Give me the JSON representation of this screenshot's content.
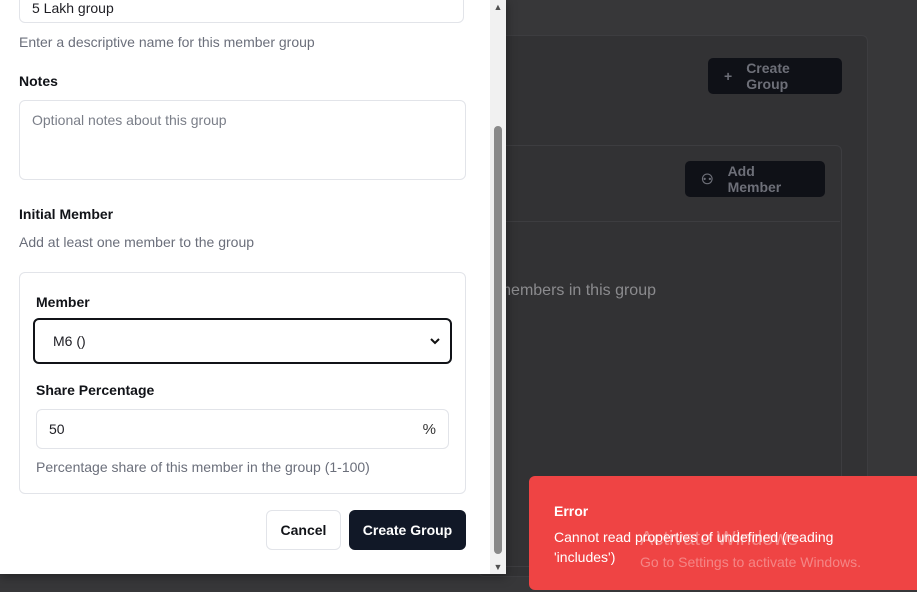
{
  "background": {
    "create_group_label": "Create Group",
    "add_member_label": "Add Member",
    "empty_text": "No members in this group",
    "plus_icon": "+",
    "user_plus_icon": "⚇"
  },
  "modal": {
    "group_name": {
      "value": "5 Lakh group",
      "helper": "Enter a descriptive name for this member group"
    },
    "notes": {
      "label": "Notes",
      "placeholder": "Optional notes about this group"
    },
    "initial_member": {
      "heading": "Initial Member",
      "subheading": "Add at least one member to the group",
      "member_label": "Member",
      "member_selected": "M6 ()",
      "share_label": "Share Percentage",
      "share_value": "50",
      "share_suffix": "%",
      "share_helper": "Percentage share of this member in the group (1-100)"
    },
    "buttons": {
      "cancel": "Cancel",
      "create": "Create Group"
    }
  },
  "toast": {
    "title": "Error",
    "message": "Cannot read properties of undefined (reading 'includes')",
    "color": "#ef4444"
  },
  "watermark": {
    "title": "Activate Windows",
    "subtitle": "Go to Settings to activate Windows."
  }
}
